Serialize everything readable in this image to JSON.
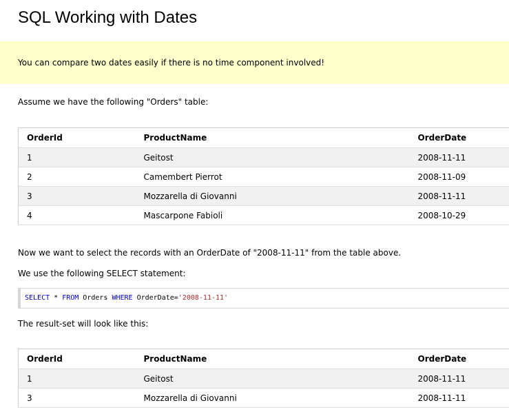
{
  "page": {
    "title": "SQL Working with Dates"
  },
  "note": {
    "text": "You can compare two dates easily if there is no time component involved!"
  },
  "intro": {
    "text": "Assume we have the following \"Orders\" table:"
  },
  "orders_table": {
    "headers": [
      "OrderId",
      "ProductName",
      "OrderDate"
    ],
    "rows": [
      [
        "1",
        "Geitost",
        "2008-11-11"
      ],
      [
        "2",
        "Camembert Pierrot",
        "2008-11-09"
      ],
      [
        "3",
        "Mozzarella di Giovanni",
        "2008-11-11"
      ],
      [
        "4",
        "Mascarpone Fabioli",
        "2008-10-29"
      ]
    ]
  },
  "explain": {
    "select_records": "Now we want to select the records with an OrderDate of \"2008-11-11\" from the table above.",
    "statement_intro": "We use the following SELECT statement:",
    "result_intro": "The result-set will look like this:"
  },
  "code": {
    "kw_select": "SELECT",
    "star": " * ",
    "kw_from": "FROM",
    "table": " Orders ",
    "kw_where": "WHERE",
    "condition": " OrderDate=",
    "literal": "'2008-11-11'",
    "keyword_color": "#0000cd",
    "string_color": "#a52a2a"
  },
  "result_table": {
    "headers": [
      "OrderId",
      "ProductName",
      "OrderDate"
    ],
    "rows": [
      [
        "1",
        "Geitost",
        "2008-11-11"
      ],
      [
        "3",
        "Mozzarella di Giovanni",
        "2008-11-11"
      ]
    ]
  }
}
